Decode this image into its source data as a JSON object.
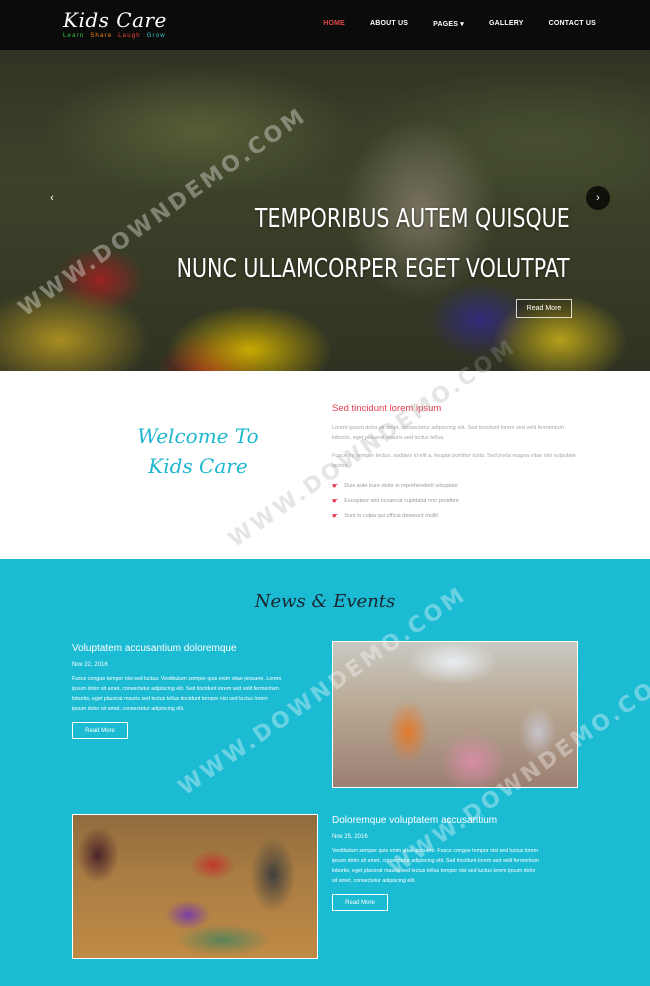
{
  "nav": {
    "logo_title": "Kids Care",
    "logo_tag": [
      {
        "word": "Learn",
        "color": "#2ecc40"
      },
      {
        "word": "Share",
        "color": "#ff851b"
      },
      {
        "word": "Laugh",
        "color": "#ff4136"
      },
      {
        "word": "Grow",
        "color": "#39cccc"
      }
    ],
    "menu": [
      "HOME",
      "ABOUT US",
      "PAGES ▾",
      "GALLERY",
      "CONTACT US"
    ],
    "active_color": "#e24a4a"
  },
  "hero": {
    "title_line1": "TEMPORIBUS AUTEM QUISQUE",
    "title_line2": "NUNC ULLAMCORPER EGET VOLUTPAT",
    "button": "Read More",
    "prev": "‹",
    "next": "›"
  },
  "welcome": {
    "title_line1": "Welcome To",
    "title_line2": "Kids Care",
    "heading": "Sed tincidunt lorem ipsum",
    "para1": "Lorem ipsum dolor sit amet, consectetur adipiscing elit. Sed tincidunt lorem sed velit fermentum lobortis, eget placerat mauris sed lectus tellus.",
    "para2": "Fusce ex semper lectus, sodales id elit a, feugiat porttitor nulla. Sed porta magna vitae nisi vulputate lacinia.",
    "list": [
      "Duis aute irure dolor in reprehenderit voluptate",
      "Excepteur sint occaecat cupidatat non proident",
      "Sunt in culpa qui officia deserunt mollit"
    ],
    "accent": "#1fb7cf"
  },
  "news": {
    "title": "News & Events",
    "articles": [
      {
        "title": "Voluptatem accusantium doloremque",
        "date": "Nov 22, 2016",
        "body": "Fusce congue tempor nisi sed luctus. Vestibulum semper quis enim vitae posuere. Lorem ipsum dolor sit amet, consectetur adipiscing elit. Sed tincidunt lorem sed velit fermentum lobortis, eget placerat mauris sed lectus tellus tincidunt tempor nisi sed luctus lorem ipsum dolor sit amet, consectetur adipiscing elit.",
        "button": "Read More"
      },
      {
        "title": "Doloremque voluptatem accusantium",
        "date": "Nov 25, 2016",
        "body": "Vestibulum semper quis enim vitae posuere. Fusce congue tempor nisi sed luctus lorem ipsum dolor sit amet, consectetur adipiscing elit. Sed tincidunt lorem sed velit fermentum lobortis, eget placerat mauris sed lectus tellus tempor nisi sed luctus lorem ipsum dolor sit amet, consectetur adipiscing elit.",
        "button": "Read More"
      }
    ],
    "background": "#1bbbd4"
  },
  "watermark": "WWW.DOWNDEMO.COM"
}
